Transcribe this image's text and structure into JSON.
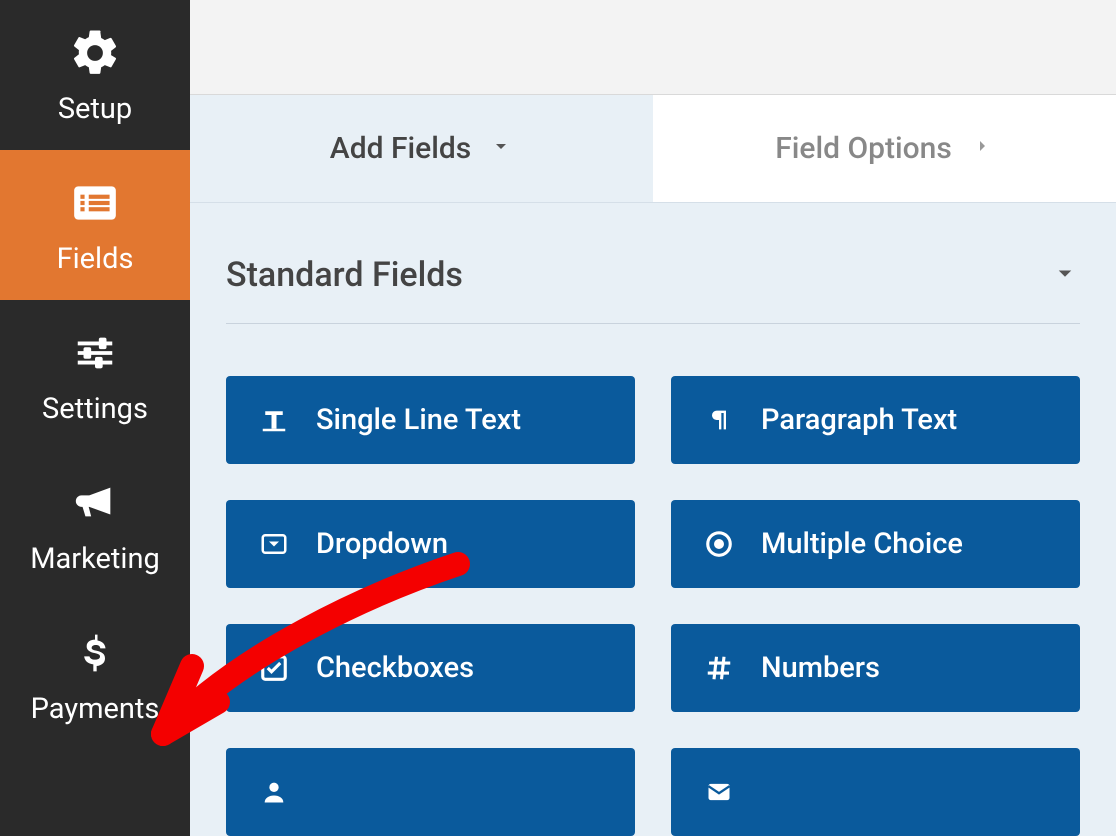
{
  "sidebar": {
    "items": [
      {
        "label": "Setup"
      },
      {
        "label": "Fields"
      },
      {
        "label": "Settings"
      },
      {
        "label": "Marketing"
      },
      {
        "label": "Payments"
      }
    ]
  },
  "tabs": {
    "add_fields": "Add Fields",
    "field_options": "Field Options"
  },
  "section": {
    "title": "Standard Fields"
  },
  "fields": {
    "single_line_text": "Single Line Text",
    "paragraph_text": "Paragraph Text",
    "dropdown": "Dropdown",
    "multiple_choice": "Multiple Choice",
    "checkboxes": "Checkboxes",
    "numbers": "Numbers"
  },
  "colors": {
    "accent": "#e27730",
    "field_button": "#0a5a9c",
    "panel": "#e8f0f6",
    "sidebar": "#2a2a2a"
  }
}
